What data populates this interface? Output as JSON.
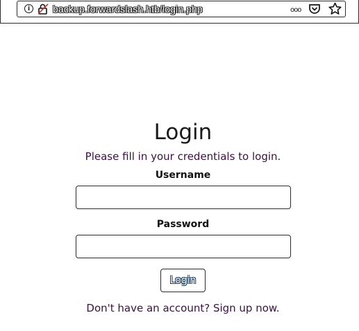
{
  "browser": {
    "url": "backup.forwardslash.htb/login.php",
    "icons": [
      "info-icon",
      "insecure-lock-icon",
      "more-actions-icon",
      "pocket-icon",
      "bookmark-star-icon"
    ]
  },
  "login": {
    "title": "Login",
    "subtitle": "Please fill in your credentials to login.",
    "username_label": "Username",
    "username_value": "",
    "password_label": "Password",
    "password_value": "",
    "button_label": "Login",
    "signup_text": "Don't have an account? Sign up now."
  }
}
